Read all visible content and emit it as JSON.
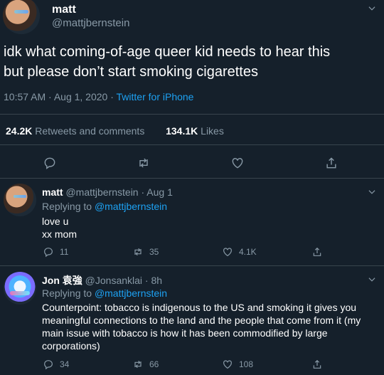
{
  "main_tweet": {
    "author_name": "matt",
    "author_handle": "@mattjbernstein",
    "text_line1": "idk what coming-of-age queer kid needs to hear this",
    "text_line2": "but please don’t start smoking cigarettes",
    "time": "10:57 AM · Aug 1, 2020 · ",
    "source": "Twitter for iPhone",
    "retweets_count": "24.2K",
    "retweets_label": "Retweets and comments",
    "likes_count": "134.1K",
    "likes_label": "Likes"
  },
  "replies": [
    {
      "name": "matt",
      "handle_date": "@mattjbernstein · Aug 1",
      "replying_label": "Replying to ",
      "replying_to": "@mattjbernstein",
      "text_lines": [
        "love u",
        "xx mom"
      ],
      "comments": "11",
      "retweets": "35",
      "likes": "4.1K"
    },
    {
      "name": "Jon 袁強",
      "handle_date": "@Jonsanklai · 8h",
      "replying_label": "Replying to ",
      "replying_to": "@mattjbernstein",
      "text": "Counterpoint: tobacco is indigenous to the US and smoking it gives you meaningful connections to the land and the people that come from it (my main issue with tobacco is how it has been commodified by large corporations)",
      "comments": "34",
      "retweets": "66",
      "likes": "108"
    }
  ],
  "icons": {
    "comment": "comment-icon",
    "retweet": "retweet-icon",
    "like": "heart-icon",
    "share": "share-icon",
    "menu": "chevron-down-icon"
  },
  "colors": {
    "background": "#15202b",
    "muted": "#8899a6",
    "accent": "#1da1f2",
    "border": "#38444d"
  }
}
